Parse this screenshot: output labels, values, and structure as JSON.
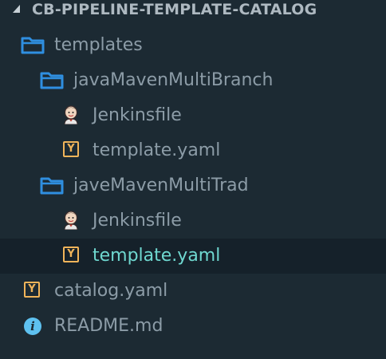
{
  "explorer": {
    "section_title": "CB-PIPELINE-TEMPLATE-CATALOG",
    "tree": {
      "templates": "templates",
      "java_multibranch": "javaMavenMultiBranch",
      "java_multibranch_jenkinsfile": "Jenkinsfile",
      "java_multibranch_template": "template.yaml",
      "jave_multitrad": "javeMavenMultiTrad",
      "jave_multitrad_jenkinsfile": "Jenkinsfile",
      "jave_multitrad_template": "template.yaml",
      "catalog": "catalog.yaml",
      "readme": "README.md"
    },
    "icons": {
      "folder": "folder-icon",
      "yaml": "yaml-file-icon",
      "yaml_glyph": "Y",
      "jenkins": "jenkins-icon",
      "info": "info-icon",
      "info_glyph": "i"
    },
    "colors": {
      "background": "#1c2a33",
      "text": "#8c9ca7",
      "selected_text": "#6fd8d0",
      "selected_row": "#15212a",
      "folder": "#2f8fe0",
      "yaml": "#f0b45a",
      "info": "#5ec1f0"
    }
  }
}
